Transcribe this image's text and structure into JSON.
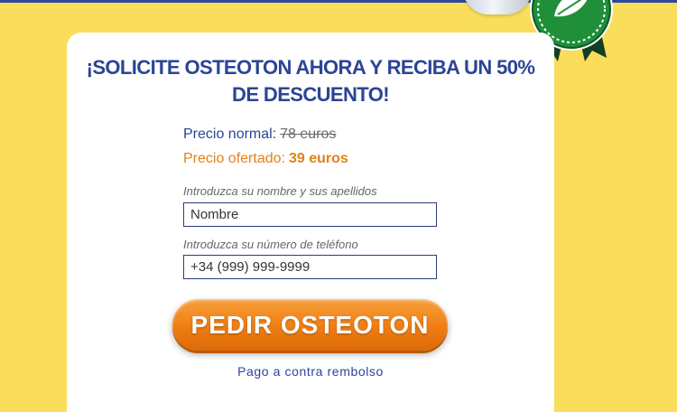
{
  "headline": "¡SOLICITE OSTEOTON AHORA Y RECIBA UN 50% DE DESCUENTO!",
  "pricing": {
    "normal_label": "Precio normal:",
    "normal_value": "78 euros",
    "offer_label": "Precio ofertado:",
    "offer_value": "39 euros"
  },
  "form": {
    "name_label": "Introduzca su nombre y sus apellidos",
    "name_placeholder": "Nombre",
    "phone_label": "Introduzca su número de teléfono",
    "phone_placeholder": "+34 (999) 999-9999"
  },
  "cta": {
    "label": "PEDIR OSTEOTON"
  },
  "payment_note": "Pago a contra rembolso",
  "colors": {
    "background": "#f9dd5b",
    "headline": "#2b4496",
    "offer": "#e0821a",
    "button": "#ef7d12",
    "badge": "#1f8f3a"
  },
  "icons": {
    "badge": "quality-seal-icon",
    "product": "product-bottle-image"
  }
}
